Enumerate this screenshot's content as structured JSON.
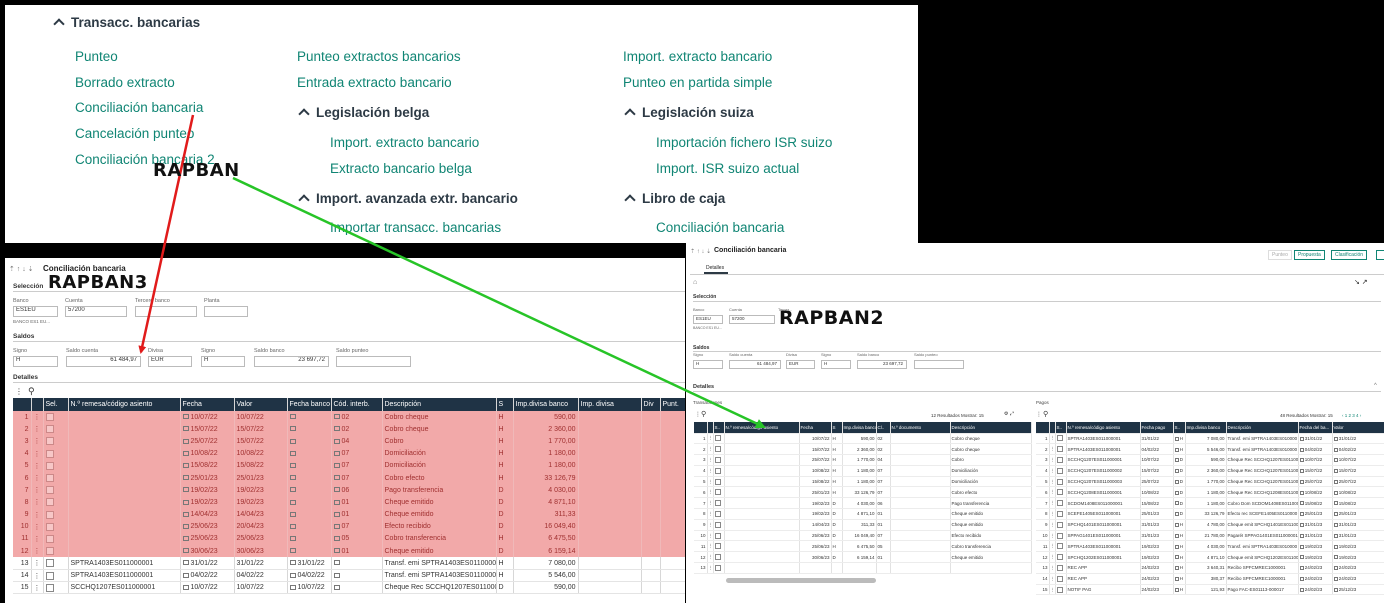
{
  "menu": {
    "section_title": "Transacc. bancarias",
    "col1": [
      "Punteo",
      "Borrado extracto",
      "Conciliación bancaria",
      "Cancelación punteo",
      "Conciliación bancaria 2"
    ],
    "col2_items": [
      "Punteo extractos bancarios",
      "Entrada extracto bancario"
    ],
    "col2_group1": {
      "title": "Legislación belga",
      "items": [
        "Import. extracto bancario",
        "Extracto bancario belga"
      ]
    },
    "col2_group2": {
      "title": "Import. avanzada extr. bancario",
      "items": [
        "Importar transacc. bancarias"
      ]
    },
    "col3_items": [
      "Import. extracto bancario",
      "Punteo en partida simple"
    ],
    "col3_group1": {
      "title": "Legislación suiza",
      "items": [
        "Importación fichero ISR suizo",
        "Import. ISR suizo actual"
      ]
    },
    "col3_group2": {
      "title": "Libro de caja",
      "items": [
        "Conciliación bancaria"
      ]
    }
  },
  "annotations": {
    "rapban": "RAPBAN",
    "rapban3": "RAPBAN3",
    "rapban2": "RAPBAN2",
    "arrow_red": "#e11b1b",
    "arrow_green": "#27c427"
  },
  "p3": {
    "toolbar": "⇡ ↑ ↓ ⇣",
    "title": "Conciliación bancaria",
    "seleccion": "Selección",
    "banco_label": "Banco",
    "banco": "ES1EU",
    "banco_sub": "BANCO ES1 EU...",
    "cuenta_label": "Cuenta",
    "cuenta": "57200",
    "tercero_label": "Tercero banco",
    "planta_label": "Planta",
    "saldos": "Saldos",
    "signo_label": "Signo",
    "signo": "H",
    "saldo_cuenta_label": "Saldo cuenta",
    "saldo_cuenta": "61 484,97",
    "divisa_label": "Divisa",
    "divisa": "EUR",
    "signo2_label": "Signo",
    "signo2": "H",
    "saldo_banco_label": "Saldo banco",
    "saldo_banco": "23 697,72",
    "saldo_punteo_label": "Saldo punteo",
    "detalles": "Detalles",
    "columns": [
      "",
      "",
      "Sel.",
      "N.º remesa/código asiento",
      "Fecha",
      "Valor",
      "Fecha banco",
      "Cód. interb.",
      "Descripción",
      "S",
      "Imp.divisa banco",
      "Imp. divisa",
      "Div",
      "Punt."
    ],
    "red_rows": [
      [
        "1",
        "",
        "10/07/22",
        "10/07/22",
        "",
        "02",
        "Cobro cheque",
        "H",
        "590,00"
      ],
      [
        "2",
        "",
        "15/07/22",
        "15/07/22",
        "",
        "02",
        "Cobro cheque",
        "H",
        "2 360,00"
      ],
      [
        "3",
        "",
        "25/07/22",
        "15/07/22",
        "",
        "04",
        "Cobro",
        "H",
        "1 770,00"
      ],
      [
        "4",
        "",
        "10/08/22",
        "10/08/22",
        "",
        "07",
        "Domiciliación",
        "H",
        "1 180,00"
      ],
      [
        "5",
        "",
        "15/08/22",
        "15/08/22",
        "",
        "07",
        "Domiciliación",
        "H",
        "1 180,00"
      ],
      [
        "6",
        "",
        "25/01/23",
        "25/01/23",
        "",
        "07",
        "Cobro efecto",
        "H",
        "33 126,79"
      ],
      [
        "7",
        "",
        "19/02/23",
        "19/02/23",
        "",
        "06",
        "Pago transferencia",
        "D",
        "4 030,00"
      ],
      [
        "8",
        "",
        "19/02/23",
        "19/02/23",
        "",
        "01",
        "Cheque emitido",
        "D",
        "4 871,10"
      ],
      [
        "9",
        "",
        "14/04/23",
        "14/04/23",
        "",
        "01",
        "Cheque emitido",
        "D",
        "311,33"
      ],
      [
        "10",
        "",
        "25/06/23",
        "20/04/23",
        "",
        "07",
        "Efecto recibido",
        "D",
        "16 049,40"
      ],
      [
        "11",
        "",
        "25/06/23",
        "25/06/23",
        "",
        "05",
        "Cobro transferencia",
        "H",
        "6 475,50"
      ],
      [
        "12",
        "",
        "30/06/23",
        "30/06/23",
        "",
        "01",
        "Cheque emitido",
        "D",
        "6 159,14"
      ]
    ],
    "white_rows": [
      [
        "13",
        "SPTRA1403ES011000001",
        "31/01/22",
        "31/01/22",
        "31/01/22",
        "",
        "Transf. emi SPTRA1403ES0110000",
        "H",
        "7 080,00"
      ],
      [
        "14",
        "SPTRA1403ES011000001",
        "04/02/22",
        "04/02/22",
        "04/02/22",
        "",
        "Transf. emi SPTRA1403ES0110000",
        "H",
        "5 546,00"
      ],
      [
        "15",
        "SCCHQ1207ES011000001",
        "10/07/22",
        "10/07/22",
        "10/07/22",
        "",
        "Cheque Rec SCCHQ1207ES0110000",
        "D",
        "590,00"
      ]
    ]
  },
  "p2": {
    "toolbar": "⇡ ↑ ↓ ⇣",
    "title": "Conciliación bancaria",
    "btn_punteo": "Punteo",
    "btn_propuesta": "Propuesta",
    "btn_clasificacion": "Clasificación",
    "tab": "Detalles",
    "seleccion": "Selección",
    "banco_label": "Banco",
    "banco": "ES1EU",
    "banco_sub": "BANCO ES1 EU...",
    "cuenta_label": "Cuenta",
    "cuenta": "57200",
    "tercero_label": "Tercer...",
    "saldos": "Saldos",
    "signo_label": "Signo",
    "signo": "H",
    "saldo_cuenta_label": "Saldo cuenta",
    "saldo_cuenta": "61 484,97",
    "divisa_label": "Divisa",
    "divisa": "EUR",
    "signo2_label": "Signo",
    "signo2": "H",
    "saldo_banco_label": "Saldo banco",
    "saldo_banco": "23 697,72",
    "saldo_punteo_label": "Saldo punteo",
    "detalles": "Detalles",
    "transacciones": "Transacciones",
    "pagos": "Pagos",
    "left_results": "12 Resultados  Mostrar: 15",
    "right_results": "48 Resultados  Mostrar: 15",
    "right_pages": "‹ 1 2 3 4 ›",
    "left_columns": [
      "",
      "",
      "S..",
      "N.º remesa/código asiento",
      "Fecha",
      "S",
      "Imp.divisa banco",
      "Cl..",
      "N.º documento",
      "Descripción"
    ],
    "left_rows": [
      [
        "1",
        "10/07/22",
        "H",
        "590,00",
        "02",
        "Cobro cheque"
      ],
      [
        "2",
        "15/07/22",
        "H",
        "2 360,00",
        "02",
        "Cobro cheque"
      ],
      [
        "3",
        "25/07/22",
        "H",
        "1 770,00",
        "04",
        "Cobro"
      ],
      [
        "4",
        "10/08/22",
        "H",
        "1 180,00",
        "07",
        "Domiciliación"
      ],
      [
        "5",
        "15/08/22",
        "H",
        "1 180,00",
        "07",
        "Domiciliación"
      ],
      [
        "6",
        "25/01/23",
        "H",
        "33 126,79",
        "07",
        "Cobro efecto"
      ],
      [
        "7",
        "19/02/23",
        "D",
        "4 030,00",
        "06",
        "Pago transferencia"
      ],
      [
        "8",
        "19/02/23",
        "D",
        "4 871,10",
        "01",
        "Cheque emitido"
      ],
      [
        "9",
        "14/04/23",
        "D",
        "311,33",
        "01",
        "Cheque emitido"
      ],
      [
        "10",
        "25/06/23",
        "D",
        "16 049,40",
        "07",
        "Efecto recibido"
      ],
      [
        "11",
        "25/06/23",
        "H",
        "6 475,50",
        "05",
        "Cobro transferencia"
      ],
      [
        "12",
        "30/06/23",
        "D",
        "6 159,14",
        "01",
        "Cheque emitido"
      ],
      [
        "13",
        "",
        "",
        "",
        "",
        ""
      ]
    ],
    "right_columns": [
      "",
      "",
      "S..",
      "N.º remesa/código asiento",
      "Fecha pago",
      "S..",
      "Imp.divisa banco",
      "Descripción",
      "Fecha del ba...",
      "Valor"
    ],
    "right_rows": [
      [
        "1",
        "SPTRA1403ES011000001",
        "31/01/22",
        "H",
        "7 080,00",
        "Transf. emi SPTRA1403ES010000",
        "31/01/22",
        "31/01/22"
      ],
      [
        "2",
        "SPTRA1403ES011000001",
        "04/02/22",
        "H",
        "5 546,00",
        "Transf. emi SPTRA1403ES010000",
        "04/02/22",
        "04/02/22"
      ],
      [
        "3",
        "SCCHQ1207ES011000001",
        "10/07/22",
        "D",
        "590,00",
        "Cheque Rec SCCHQ1207ES0110000",
        "10/07/22",
        "10/07/22"
      ],
      [
        "4",
        "SCCHQ1207ES011000002",
        "15/07/22",
        "D",
        "2 360,00",
        "Cheque Rec SCCHQ1207ES0110000",
        "15/07/22",
        "15/07/22"
      ],
      [
        "5",
        "SCCHQ1207ES011000003",
        "25/07/22",
        "D",
        "1 770,00",
        "Cheque Rec SCCHQ1207ES0110000",
        "25/07/22",
        "25/07/22"
      ],
      [
        "6",
        "SCCHQ1208ES011000001",
        "10/08/22",
        "D",
        "1 180,00",
        "Cheque Rec SCCHQ1208ES0110000",
        "10/08/22",
        "10/08/22"
      ],
      [
        "7",
        "SCDOM1408ES011000001",
        "15/08/22",
        "D",
        "1 180,00",
        "Cobro Dom SCDOM1408ES0110000",
        "15/08/22",
        "15/08/22"
      ],
      [
        "8",
        "SCEFE1405ES011000001",
        "25/01/23",
        "D",
        "33 126,79",
        "Efecto rec SCEFE1405ES0110000",
        "25/01/23",
        "25/01/23"
      ],
      [
        "9",
        "SPCHQ1401ES011000001",
        "31/01/23",
        "H",
        "4 780,00",
        "Cheque emit SPCHQ1401ES0110000",
        "31/01/23",
        "31/01/23"
      ],
      [
        "10",
        "SPPAG1401ES011000001",
        "31/01/23",
        "H",
        "21 780,00",
        "PagaréI SPPAG1401ES011000001",
        "31/01/23",
        "31/01/23"
      ],
      [
        "11",
        "SPTRA1403ES011000001",
        "19/02/23",
        "H",
        "4 030,00",
        "Transf. emi SPTRA1403ES010000",
        "19/02/23",
        "19/02/23"
      ],
      [
        "12",
        "SPCHQ1202ES011000001",
        "19/02/23",
        "H",
        "4 871,10",
        "Cheque emit SPCHQ1202ES0110000",
        "19/02/23",
        "19/02/23"
      ],
      [
        "13",
        "REC APP",
        "24/02/23",
        "H",
        "3 640,31",
        "Recibo SPFCMREC1000001",
        "24/02/23",
        "24/02/23"
      ],
      [
        "14",
        "REC APP",
        "24/02/23",
        "H",
        "380,37",
        "Recibo SPFCMREC1000001",
        "24/02/23",
        "24/02/23"
      ],
      [
        "15",
        "NOTIF PAG",
        "24/02/23",
        "H",
        "121,93",
        "Pago FAC-ES01113-000017",
        "24/02/23",
        "25/12/23"
      ]
    ]
  }
}
